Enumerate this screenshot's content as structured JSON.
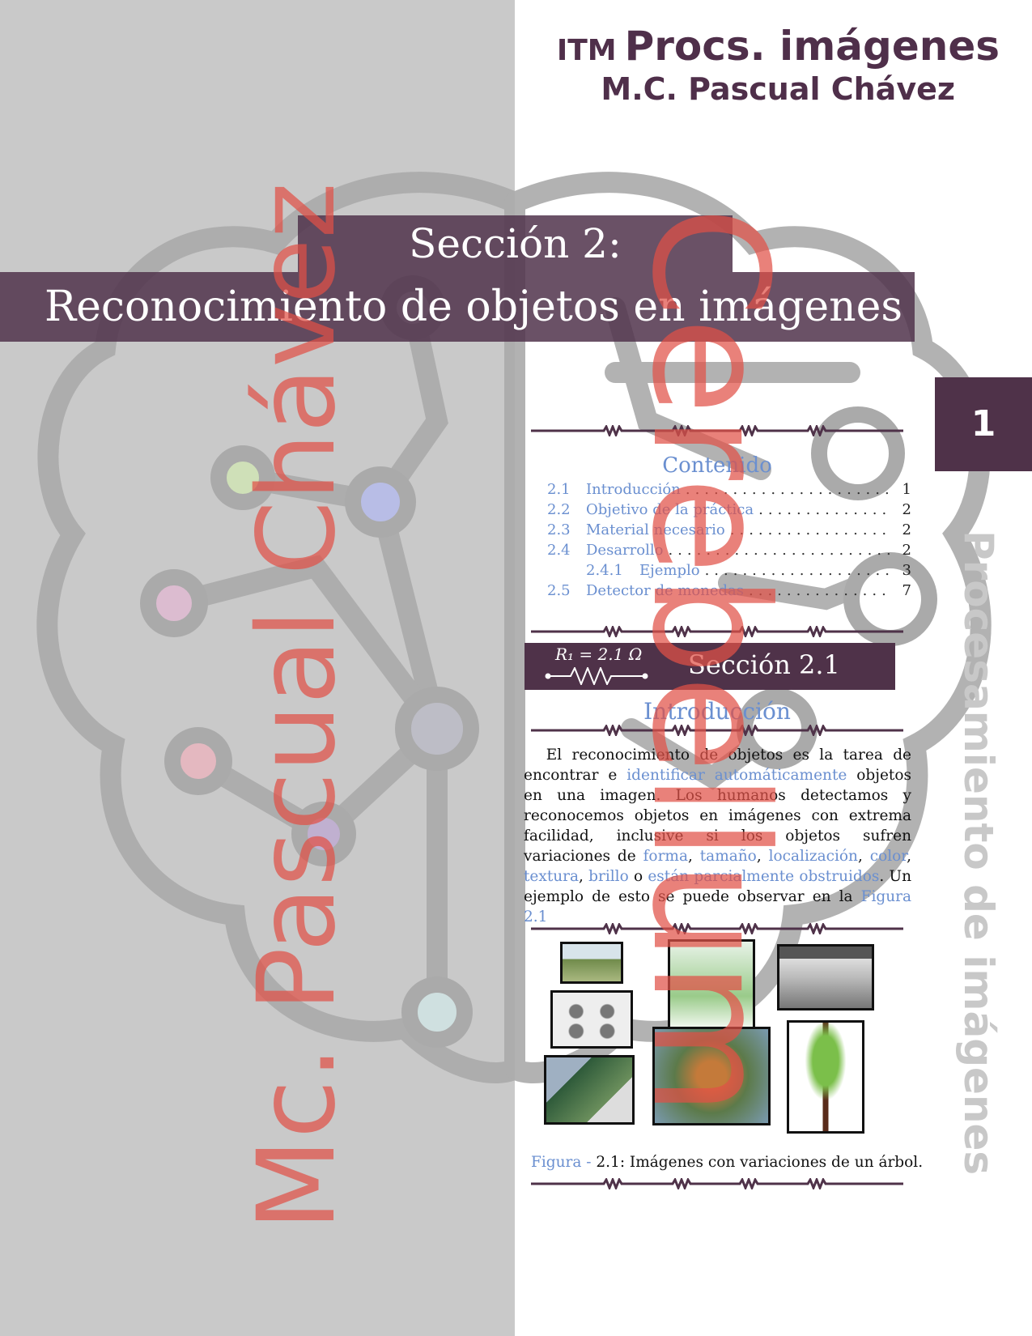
{
  "header": {
    "org": "ITM",
    "course": "Procs. imágenes",
    "author": "M.C. Pascual Chávez"
  },
  "section": {
    "label": "Sección 2:",
    "title": "Reconocimiento de objetos en imágenes"
  },
  "page_number": "1",
  "side_title": "Procesamiento de imágenes",
  "toc": {
    "title": "Contenido",
    "entries": [
      {
        "num": "2.1",
        "label": "Introducción",
        "page": "1"
      },
      {
        "num": "2.2",
        "label": "Objetivo de la práctica",
        "page": "2"
      },
      {
        "num": "2.3",
        "label": "Material necesario",
        "page": "2"
      },
      {
        "num": "2.4",
        "label": "Desarrollo",
        "page": "2"
      },
      {
        "num": "2.4.1",
        "label": "Ejemplo",
        "page": "3"
      },
      {
        "num": "2.5",
        "label": "Detector de monedas",
        "page": "7"
      }
    ]
  },
  "subsection": {
    "resistor_label": "R₁ = 2.1 Ω",
    "title": "Sección 2.1",
    "heading": "Introducción"
  },
  "paragraph": {
    "t1": "El reconocimiento de objetos es la tarea de encontrar e ",
    "l1": "identificar automáticamente",
    "t2": " objetos en una imagen. Los humanos detectamos y reconocemos objetos en imágenes con extrema facilidad, inclusive si los objetos sufren variaciones de ",
    "l2": "forma",
    "t3": ", ",
    "l3": "tamaño",
    "t4": ", ",
    "l4": "localización",
    "t5": ", ",
    "l5": "color",
    "t6": ", ",
    "l6": "textura",
    "t7": ", ",
    "l7": "brillo",
    "t8": " o ",
    "l8": "están parcialmente obstruidos",
    "t9": ". Un ejemplo de esto se puede observar en la ",
    "l9": "Figura 2.1"
  },
  "figure": {
    "prefix": "Figura -",
    "caption": " 2.1: Imágenes con variaciones de un árbol."
  },
  "watermarks": {
    "left": "Mc. Pascual Chávez",
    "center": "Cerebellum"
  },
  "colors": {
    "primary": "#4f3249",
    "link": "#6a8fd0",
    "watermark": "#e15046"
  }
}
